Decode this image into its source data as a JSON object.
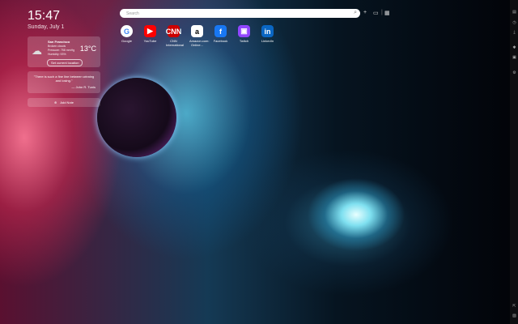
{
  "clock": {
    "time": "15:47",
    "date": "Sunday, July 1"
  },
  "weather": {
    "city": "San Francisco",
    "condition": "Broken clouds",
    "pressure": "Pressure: 758 mmHg",
    "humidity": "Humidity: 93%",
    "temperature": "13°C",
    "location_button": "Set current location"
  },
  "quote": {
    "text": "\"There is such a fine line between winning and losing.\"",
    "author": "— John R. Tunis"
  },
  "note": {
    "add_label": "Add Note"
  },
  "search": {
    "placeholder": "Search"
  },
  "dials": [
    {
      "label": "Google",
      "icon": "G",
      "bg": "#ffffff",
      "fg": "#4285f4"
    },
    {
      "label": "YouTube",
      "icon": "▶",
      "bg": "#ff0000",
      "fg": "#ffffff"
    },
    {
      "label": "CNN International",
      "icon": "CNN",
      "bg": "#cc0000",
      "fg": "#ffffff"
    },
    {
      "label": "Amazon.com: Online...",
      "icon": "a",
      "bg": "#ffffff",
      "fg": "#000000"
    },
    {
      "label": "Facebook",
      "icon": "f",
      "bg": "#1877f2",
      "fg": "#ffffff"
    },
    {
      "label": "Twitch",
      "icon": "▣",
      "bg": "#9146ff",
      "fg": "#ffffff"
    },
    {
      "label": "LinkedIn",
      "icon": "in",
      "bg": "#0a66c2",
      "fg": "#ffffff"
    }
  ]
}
